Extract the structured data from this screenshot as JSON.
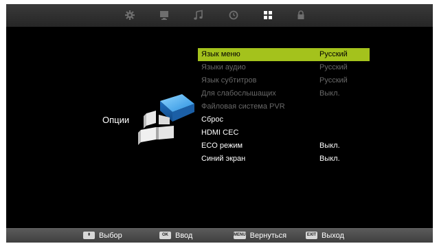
{
  "tabs": [
    {
      "icon": "gear-icon",
      "active": false
    },
    {
      "icon": "monitor-icon",
      "active": false
    },
    {
      "icon": "music-note-icon",
      "active": false
    },
    {
      "icon": "clock-icon",
      "active": false
    },
    {
      "icon": "grid-icon",
      "active": true
    },
    {
      "icon": "lock-icon",
      "active": false
    }
  ],
  "section": {
    "title": "Опции",
    "graphic_icon": "options-graphic-icon"
  },
  "menu": {
    "items": [
      {
        "label": "Язык меню",
        "value": "Русский",
        "state": "selected"
      },
      {
        "label": "Языки аудио",
        "value": "Русский",
        "state": "disabled"
      },
      {
        "label": "Язык субтитров",
        "value": "Русский",
        "state": "disabled"
      },
      {
        "label": "Для слабослышащих",
        "value": "Выкл.",
        "state": "disabled"
      },
      {
        "label": "Файловая система PVR",
        "value": "",
        "state": "disabled"
      },
      {
        "label": "Сброс",
        "value": "",
        "state": "enabled"
      },
      {
        "label": "HDMI CEC",
        "value": "",
        "state": "enabled"
      },
      {
        "label": "ECO режим",
        "value": "Выкл.",
        "state": "enabled"
      },
      {
        "label": "Синий экран",
        "value": "Выкл.",
        "state": "enabled"
      }
    ]
  },
  "footer": {
    "select_key": "⬍",
    "select_label": "Выбор",
    "ok_key": "OK",
    "ok_label": "Ввод",
    "menu_key": "MENU",
    "menu_label": "Вернуться",
    "exit_key": "EXIT",
    "exit_label": "Выход"
  },
  "colors": {
    "highlight": "#a4c21c",
    "active_tab": "#ffffff",
    "inactive_tab": "#6e6e6e",
    "disabled_text": "#686868"
  }
}
